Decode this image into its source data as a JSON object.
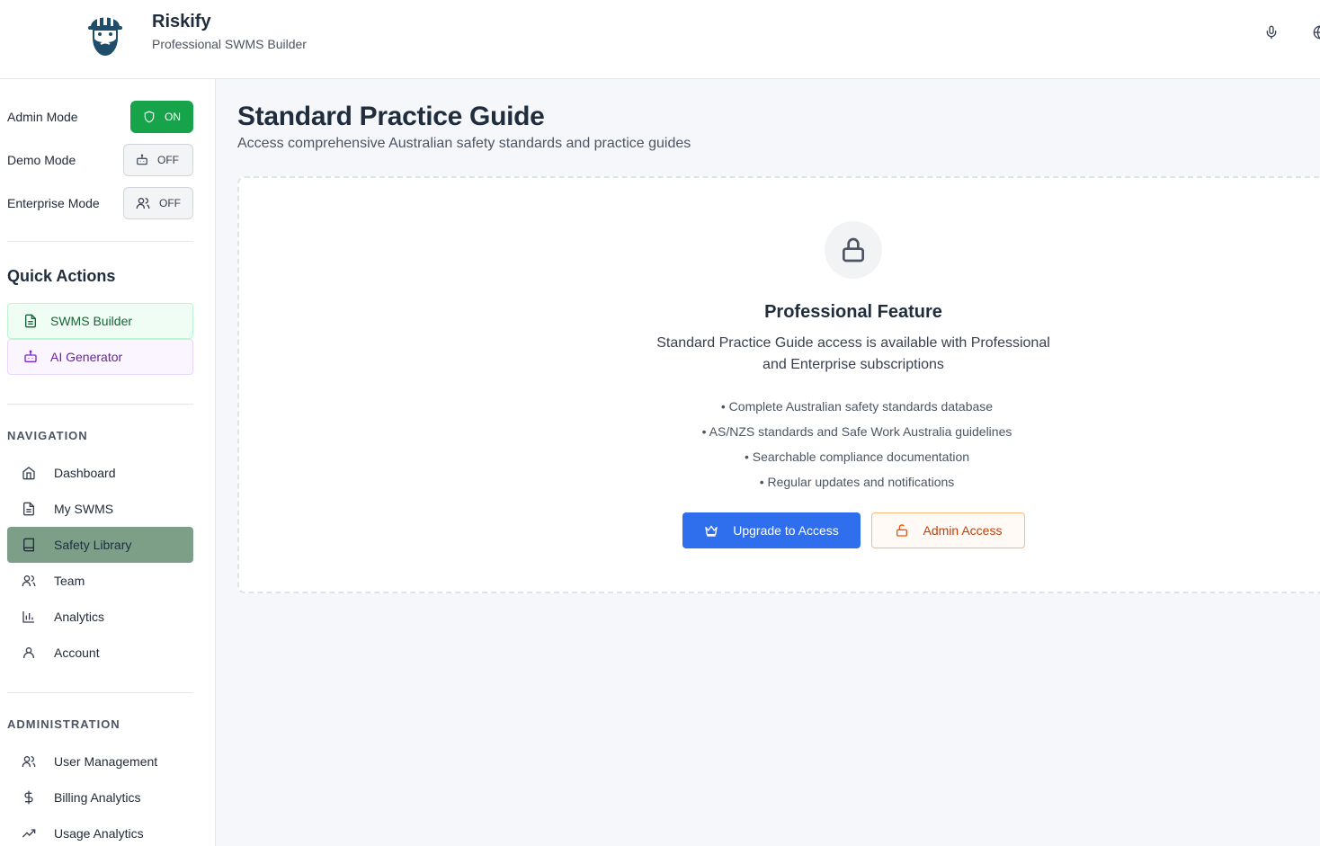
{
  "header": {
    "title": "Riskify",
    "subtitle": "Professional SWMS Builder",
    "logo_icon": "bearded-worker-hardhat-logo",
    "icons": [
      "microphone-icon",
      "globe-icon"
    ]
  },
  "sidebar": {
    "modes": [
      {
        "label": "Admin Mode",
        "state": "ON",
        "icon": "shield-icon"
      },
      {
        "label": "Demo Mode",
        "state": "OFF",
        "icon": "bot-icon"
      },
      {
        "label": "Enterprise Mode",
        "state": "OFF",
        "icon": "users-icon"
      }
    ],
    "quick_actions_title": "Quick Actions",
    "quick_actions": [
      {
        "label": "SWMS Builder",
        "icon": "file-text-icon"
      },
      {
        "label": "AI Generator",
        "icon": "bot-icon"
      }
    ],
    "navigation_label": "NAVIGATION",
    "navigation": [
      {
        "label": "Dashboard",
        "icon": "home-icon"
      },
      {
        "label": "My SWMS",
        "icon": "file-text-icon"
      },
      {
        "label": "Safety Library",
        "icon": "book-icon",
        "active": true
      },
      {
        "label": "Team",
        "icon": "users-icon"
      },
      {
        "label": "Analytics",
        "icon": "bar-chart-icon"
      },
      {
        "label": "Account",
        "icon": "user-icon"
      }
    ],
    "administration_label": "ADMINISTRATION",
    "administration": [
      {
        "label": "User Management",
        "icon": "users-icon"
      },
      {
        "label": "Billing Analytics",
        "icon": "dollar-icon"
      },
      {
        "label": "Usage Analytics",
        "icon": "trending-up-icon"
      }
    ]
  },
  "main": {
    "title": "Standard Practice Guide",
    "subtitle": "Access comprehensive Australian safety standards and practice guides",
    "feature": {
      "title": "Professional Feature",
      "description": "Standard Practice Guide access is available with Professional and Enterprise subscriptions",
      "bullets": [
        "• Complete Australian safety standards database",
        "• AS/NZS standards and Safe Work Australia guidelines",
        "• Searchable compliance documentation",
        "• Regular updates and notifications"
      ],
      "upgrade_label": "Upgrade to Access",
      "admin_label": "Admin Access"
    }
  },
  "colors": {
    "accent_blue": "#2f6fed",
    "admin_orange": "#c2410c",
    "toggle_on_green": "#16a34a",
    "active_nav": "#7d9f87"
  }
}
